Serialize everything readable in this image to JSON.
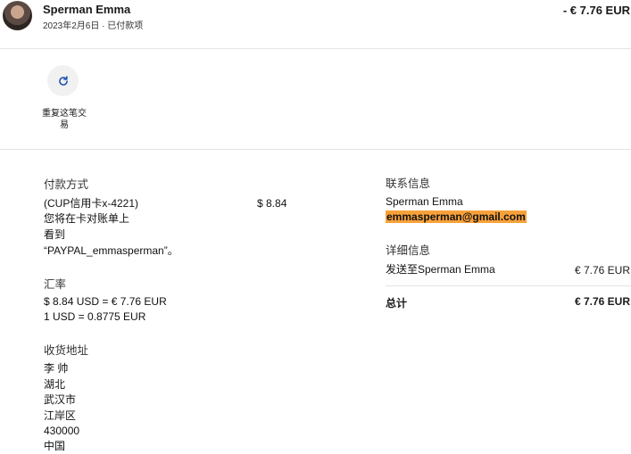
{
  "header": {
    "name": "Sperman Emma",
    "date": "2023年2月6日",
    "separator": "·",
    "status": "已付款项",
    "amount": "- € 7.76 EUR"
  },
  "actions": {
    "repeat_label": "重复这笔交易"
  },
  "payment": {
    "heading": "付款方式",
    "card": "(CUP信用卡x-4221)",
    "card_amount": "$ 8.84",
    "note_line1": "您将在卡对账单上",
    "note_line2": "看到",
    "note_line3": "“PAYPAL_emmasperman”。"
  },
  "exchange": {
    "heading": "汇率",
    "line1": "$ 8.84 USD = € 7.76 EUR",
    "line2": "1 USD = 0.8775 EUR"
  },
  "shipping": {
    "heading": "收货地址",
    "lines": [
      "李 帅",
      "湖北",
      "武汉市",
      "江岸区",
      "430000",
      "中国"
    ]
  },
  "contact": {
    "heading": "联系信息",
    "name": "Sperman Emma",
    "email": "emmasperman@gmail.com"
  },
  "details": {
    "heading": "详细信息",
    "sent_to": "发送至Sperman Emma",
    "sent_amount": "€ 7.76 EUR",
    "total_label": "总计",
    "total_amount": "€ 7.76 EUR"
  },
  "colors": {
    "email_highlight": "#f7a13a",
    "divider": "#e4e4e4"
  },
  "icons": {
    "repeat": "refresh-icon"
  }
}
